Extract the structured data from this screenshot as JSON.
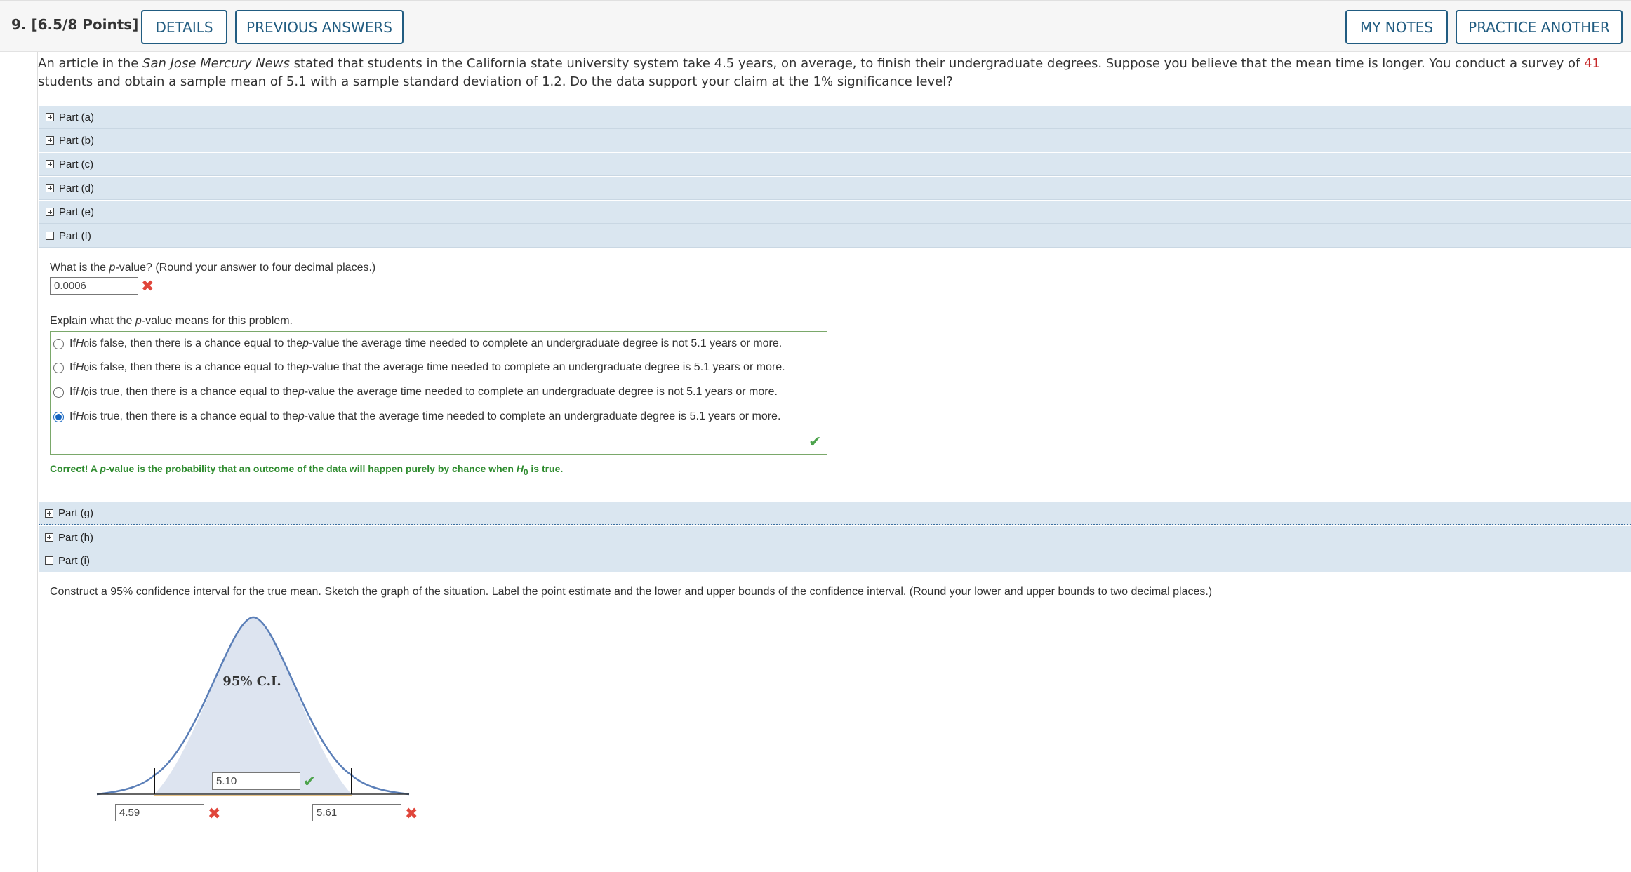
{
  "header": {
    "question_number": "9.",
    "points": "[6.5/8 Points]",
    "buttons": {
      "details": "DETAILS",
      "previous_answers": "PREVIOUS ANSWERS",
      "my_notes": "MY NOTES",
      "practice_another": "PRACTICE ANOTHER"
    }
  },
  "stem": {
    "p1": "An article in the ",
    "source": "San Jose Mercury News",
    "p2": " stated that students in the California state university system take 4.5 years, on average, to finish their undergraduate degrees. Suppose you believe that the mean time is longer. You conduct a survey of ",
    "n": "41",
    "p3": " students and obtain a sample mean of 5.1 with a sample standard deviation of 1.2. Do the data support your claim at the 1% significance level?"
  },
  "parts": {
    "a": "Part (a)",
    "b": "Part (b)",
    "c": "Part (c)",
    "d": "Part (d)",
    "e": "Part (e)",
    "f": "Part (f)",
    "g": "Part (g)",
    "h": "Part (h)",
    "i": "Part (i)"
  },
  "part_f": {
    "q1_pre": "What is the ",
    "q1_p": "p",
    "q1_post": "-value? (Round your answer to four decimal places.)",
    "p_value": "0.0006",
    "q2_pre": "Explain what the ",
    "q2_p": "p",
    "q2_post": "-value means for this problem.",
    "choices": [
      {
        "a": "If ",
        "h": "H",
        "sub": "0",
        "b": " is false, then there is a chance equal to the ",
        "p": "p",
        "c": "-value the average time needed to complete an undergraduate degree is not 5.1 years or more."
      },
      {
        "a": "If ",
        "h": "H",
        "sub": "0",
        "b": " is false, then there is a chance equal to the ",
        "p": "p",
        "c": "-value that the average time needed to complete an undergraduate degree is 5.1 years or more."
      },
      {
        "a": "If ",
        "h": "H",
        "sub": "0",
        "b": " is true, then there is a chance equal to the ",
        "p": "p",
        "c": "-value the average time needed to complete an undergraduate degree is not 5.1 years or more."
      },
      {
        "a": "If ",
        "h": "H",
        "sub": "0",
        "b": " is true, then there is a chance equal to the ",
        "p": "p",
        "c": "-value that the average time needed to complete an undergraduate degree is 5.1 years or more."
      }
    ],
    "selected_choice": 3,
    "feedback_pre": "Correct! A ",
    "feedback_p": "p",
    "feedback_mid": "-value is the probability that an outcome of the data will happen purely by chance when ",
    "feedback_h": "H",
    "feedback_sub": "0",
    "feedback_post": " is true."
  },
  "part_i": {
    "prompt": "Construct a 95% confidence interval for the true mean. Sketch the graph of the situation. Label the point estimate and the lower and upper bounds of the confidence interval. (Round your lower and upper bounds to two decimal places.)",
    "ci_label": "95% C.I.",
    "point_estimate": "5.10",
    "lower_bound": "4.59",
    "upper_bound": "5.61"
  },
  "colors": {
    "accent": "#215c81",
    "part_bg": "#dae6f0",
    "correct": "#2e8b2e",
    "incorrect": "#e0463b",
    "curve_fill": "#dde4f0",
    "curve_stroke": "#5b7fb8"
  }
}
